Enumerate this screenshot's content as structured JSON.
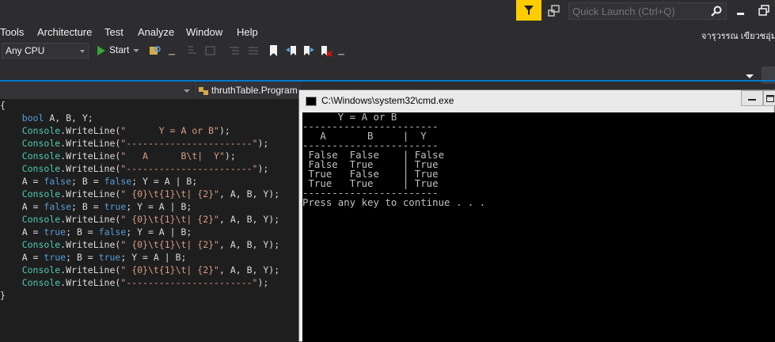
{
  "toolbar": {
    "quick_launch_placeholder": "Quick Launch (Ctrl+Q)",
    "platform": "Any CPU",
    "start_label": "Start"
  },
  "menu": [
    "Tools",
    "Architecture",
    "Test",
    "Analyze",
    "Window",
    "Help"
  ],
  "user_name": "จารุวรรณ  เขียวชอุ่ม",
  "editor": {
    "member_dropdown": "thruthTable.Program",
    "code_lines": [
      [
        [
          "tx",
          "{"
        ]
      ],
      [
        [
          "tx",
          "    "
        ],
        [
          "kw",
          "bool"
        ],
        [
          "tx",
          " A, B, Y;"
        ]
      ],
      [
        [
          "tx",
          "    "
        ],
        [
          "ty",
          "Console"
        ],
        [
          "tx",
          ".WriteLine("
        ],
        [
          "st",
          "\"      Y = A or B\""
        ],
        [
          "tx",
          ");"
        ]
      ],
      [
        [
          "tx",
          "    "
        ],
        [
          "ty",
          "Console"
        ],
        [
          "tx",
          ".WriteLine("
        ],
        [
          "st",
          "\"-----------------------\""
        ],
        [
          "tx",
          ");"
        ]
      ],
      [
        [
          "tx",
          "    "
        ],
        [
          "ty",
          "Console"
        ],
        [
          "tx",
          ".WriteLine("
        ],
        [
          "st",
          "\"   A      B\\t|  Y\""
        ],
        [
          "tx",
          ");"
        ]
      ],
      [
        [
          "tx",
          "    "
        ],
        [
          "ty",
          "Console"
        ],
        [
          "tx",
          ".WriteLine("
        ],
        [
          "st",
          "\"-----------------------\""
        ],
        [
          "tx",
          ");"
        ]
      ],
      [
        [
          "tx",
          "    A = "
        ],
        [
          "kw",
          "false"
        ],
        [
          "tx",
          "; B = "
        ],
        [
          "kw",
          "false"
        ],
        [
          "tx",
          "; Y = A | B;"
        ]
      ],
      [
        [
          "tx",
          "    "
        ],
        [
          "ty",
          "Console"
        ],
        [
          "tx",
          ".WriteLine("
        ],
        [
          "st",
          "\" {0}\\t{1}\\t| {2}\""
        ],
        [
          "tx",
          ", A, B, Y);"
        ]
      ],
      [
        [
          "tx",
          "    A = "
        ],
        [
          "kw",
          "false"
        ],
        [
          "tx",
          "; B = "
        ],
        [
          "kw",
          "true"
        ],
        [
          "tx",
          "; Y = A | B;"
        ]
      ],
      [
        [
          "tx",
          "    "
        ],
        [
          "ty",
          "Console"
        ],
        [
          "tx",
          ".WriteLine("
        ],
        [
          "st",
          "\" {0}\\t{1}\\t| {2}\""
        ],
        [
          "tx",
          ", A, B, Y);"
        ]
      ],
      [
        [
          "tx",
          "    A = "
        ],
        [
          "kw",
          "true"
        ],
        [
          "tx",
          "; B = "
        ],
        [
          "kw",
          "false"
        ],
        [
          "tx",
          "; Y = A | B;"
        ]
      ],
      [
        [
          "tx",
          "    "
        ],
        [
          "ty",
          "Console"
        ],
        [
          "tx",
          ".WriteLine("
        ],
        [
          "st",
          "\" {0}\\t{1}\\t| {2}\""
        ],
        [
          "tx",
          ", A, B, Y);"
        ]
      ],
      [
        [
          "tx",
          "    A = "
        ],
        [
          "kw",
          "true"
        ],
        [
          "tx",
          "; B = "
        ],
        [
          "kw",
          "true"
        ],
        [
          "tx",
          "; Y = A | B;"
        ]
      ],
      [
        [
          "tx",
          "    "
        ],
        [
          "ty",
          "Console"
        ],
        [
          "tx",
          ".WriteLine("
        ],
        [
          "st",
          "\" {0}\\t{1}\\t| {2}\""
        ],
        [
          "tx",
          ", A, B, Y);"
        ]
      ],
      [
        [
          "tx",
          "    "
        ],
        [
          "ty",
          "Console"
        ],
        [
          "tx",
          ".WriteLine("
        ],
        [
          "st",
          "\"-----------------------\""
        ],
        [
          "tx",
          ");"
        ]
      ],
      [
        [
          "tx",
          "}"
        ]
      ]
    ]
  },
  "cmd": {
    "title": "C:\\Windows\\system32\\cmd.exe",
    "lines": [
      "      Y = A or B",
      "-----------------------",
      "   A       B     |  Y",
      "-----------------------",
      " False  False    | False",
      " False  True     | True",
      " True   False    | True",
      " True   True     | True",
      "-----------------------",
      "Press any key to continue . . ."
    ]
  },
  "colors": {
    "accent": "#007acc",
    "notify": "#ffcc00",
    "keyword": "#569cd6",
    "type": "#4ec9b0",
    "string": "#d69d85"
  }
}
